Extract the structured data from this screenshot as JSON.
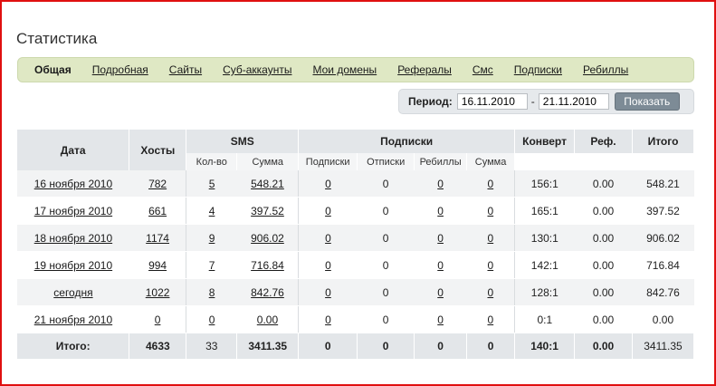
{
  "page": {
    "title": "Статистика"
  },
  "nav": {
    "items": [
      {
        "label": "Общая",
        "active": true
      },
      {
        "label": "Подробная"
      },
      {
        "label": "Сайты"
      },
      {
        "label": "Суб-аккаунты"
      },
      {
        "label": "Мои домены"
      },
      {
        "label": "Рефералы"
      },
      {
        "label": "Смс"
      },
      {
        "label": "Подписки"
      },
      {
        "label": "Ребиллы"
      }
    ]
  },
  "period": {
    "label": "Период:",
    "from": "16.11.2010",
    "dash": "-",
    "to": "21.11.2010",
    "button": "Показать"
  },
  "table": {
    "headers": {
      "date": "Дата",
      "hosts": "Хосты",
      "sms": "SMS",
      "subscriptions": "Подписки",
      "conversion": "Конверт",
      "ref": "Реф.",
      "total": "Итого"
    },
    "subheaders": {
      "sms_count": "Кол-во",
      "sms_sum": "Сумма",
      "subs": "Подписки",
      "unsubs": "Отписки",
      "rebills": "Ребиллы",
      "subs_sum": "Сумма"
    },
    "rows": [
      {
        "date": "16 ноября 2010",
        "hosts": "782",
        "sms_count": "5",
        "sms_sum": "548.21",
        "subs": "0",
        "unsubs": "0",
        "rebills": "0",
        "subs_sum": "0",
        "conv": "156:1",
        "ref": "0.00",
        "total": "548.21"
      },
      {
        "date": "17 ноября 2010",
        "hosts": "661",
        "sms_count": "4",
        "sms_sum": "397.52",
        "subs": "0",
        "unsubs": "0",
        "rebills": "0",
        "subs_sum": "0",
        "conv": "165:1",
        "ref": "0.00",
        "total": "397.52"
      },
      {
        "date": "18 ноября 2010",
        "hosts": "1174",
        "sms_count": "9",
        "sms_sum": "906.02",
        "subs": "0",
        "unsubs": "0",
        "rebills": "0",
        "subs_sum": "0",
        "conv": "130:1",
        "ref": "0.00",
        "total": "906.02"
      },
      {
        "date": "19 ноября 2010",
        "hosts": "994",
        "sms_count": "7",
        "sms_sum": "716.84",
        "subs": "0",
        "unsubs": "0",
        "rebills": "0",
        "subs_sum": "0",
        "conv": "142:1",
        "ref": "0.00",
        "total": "716.84"
      },
      {
        "date": "сегодня",
        "hosts": "1022",
        "sms_count": "8",
        "sms_sum": "842.76",
        "subs": "0",
        "unsubs": "0",
        "rebills": "0",
        "subs_sum": "0",
        "conv": "128:1",
        "ref": "0.00",
        "total": "842.76"
      },
      {
        "date": "21 ноября 2010",
        "hosts": "0",
        "sms_count": "0",
        "sms_sum": "0.00",
        "subs": "0",
        "unsubs": "0",
        "rebills": "0",
        "subs_sum": "0",
        "conv": "0:1",
        "ref": "0.00",
        "total": "0.00"
      }
    ],
    "totals": {
      "label": "Итого:",
      "hosts": "4633",
      "sms_count": "33",
      "sms_sum": "3411.35",
      "subs": "0",
      "unsubs": "0",
      "rebills": "0",
      "subs_sum": "0",
      "conv": "140:1",
      "ref": "0.00",
      "total": "3411.35"
    }
  }
}
